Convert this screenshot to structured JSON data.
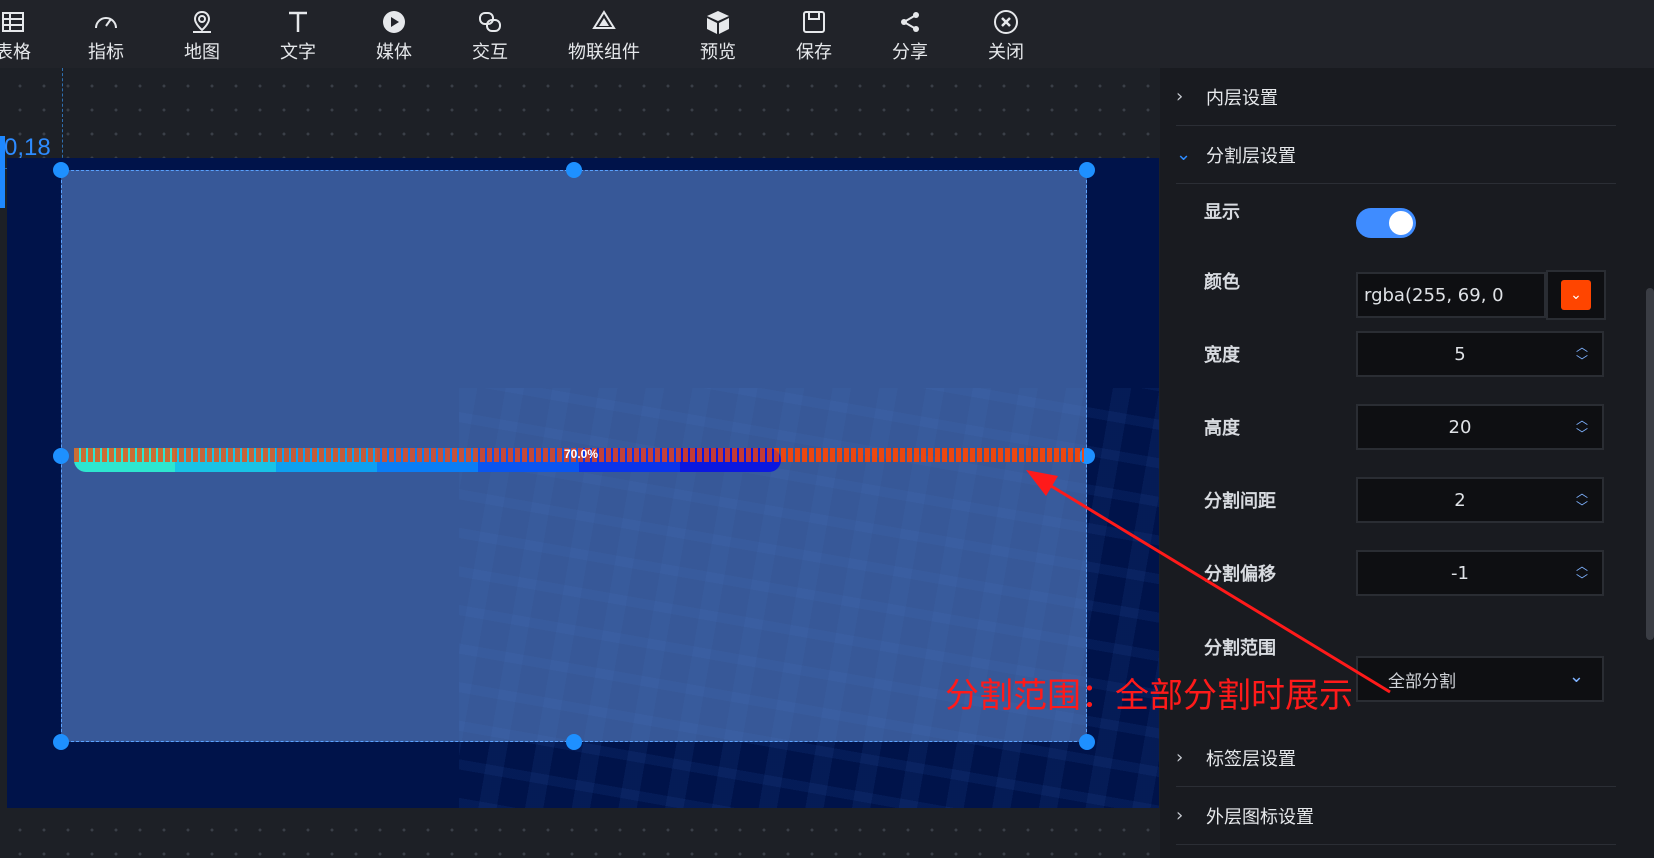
{
  "toolbar": {
    "items": [
      {
        "label": "表格",
        "icon": "table-icon"
      },
      {
        "label": "指标",
        "icon": "gauge-icon"
      },
      {
        "label": "地图",
        "icon": "map-pin-icon"
      },
      {
        "label": "文字",
        "icon": "text-icon"
      },
      {
        "label": "媒体",
        "icon": "play-icon"
      },
      {
        "label": "交互",
        "icon": "link-icon"
      },
      {
        "label": "物联组件",
        "icon": "iot-icon"
      },
      {
        "label": "预览",
        "icon": "cube-icon"
      },
      {
        "label": "保存",
        "icon": "save-icon"
      },
      {
        "label": "分享",
        "icon": "share-icon"
      },
      {
        "label": "关闭",
        "icon": "close-icon"
      }
    ]
  },
  "canvas": {
    "coord_readout": "0,18",
    "progress": {
      "percent": 0.7,
      "label": "70.0%",
      "segment_color": "#ff4500",
      "gradient_colors": [
        "#2ee6d0",
        "#19c3e6",
        "#0ea0f0",
        "#0b7df5",
        "#0a55f0",
        "#0a34ea",
        "#0b18e0"
      ]
    }
  },
  "panel": {
    "sections": {
      "inner": "内层设置",
      "segment": "分割层设置",
      "label": "标签层设置",
      "outer": "外层图标设置"
    },
    "fields": {
      "show_label": "显示",
      "show_value": true,
      "color_label": "颜色",
      "color_value": "rgba(255, 69, 0",
      "color_hex": "#ff4500",
      "width_label": "宽度",
      "width_value": "5",
      "height_label": "高度",
      "height_value": "20",
      "gap_label": "分割间距",
      "gap_value": "2",
      "offset_label": "分割偏移",
      "offset_value": "-1",
      "range_label": "分割范围",
      "range_value": "全部分割"
    }
  },
  "annotation": {
    "text": "分割范围：全部分割时展示",
    "color": "#ff1a1a"
  }
}
